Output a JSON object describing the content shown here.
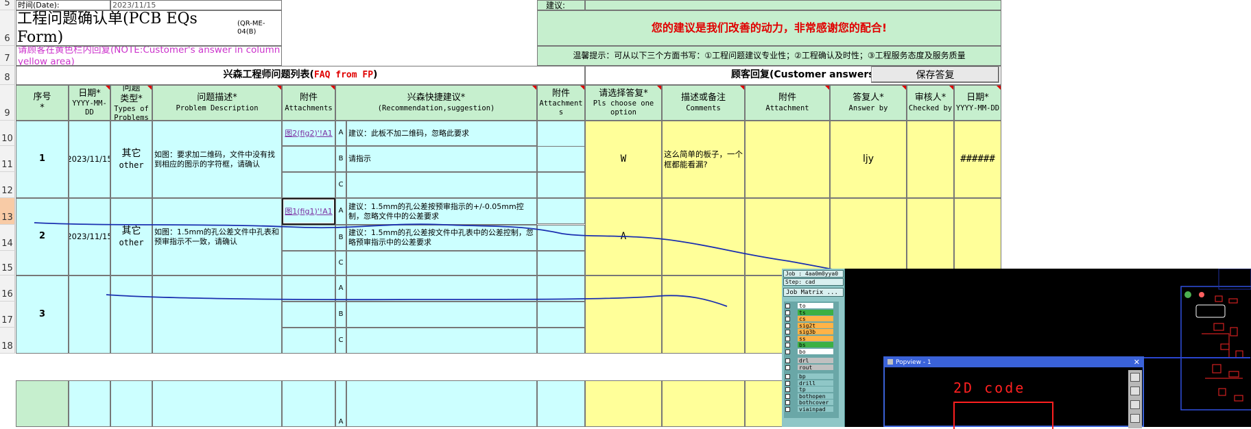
{
  "row_headers": [
    "5",
    "6",
    "7",
    "8",
    "9",
    "10",
    "11",
    "12",
    "13",
    "14",
    "15",
    "16",
    "17",
    "18"
  ],
  "top": {
    "row5_label": "时间(Date):",
    "row5_date": "2023/11/15",
    "title": "工程问题确认单(PCB EQs Form)",
    "form_code": "(QR-ME-04(B)",
    "instruction": "请顾客在黄色栏内回复(NOTE:Customer's answer in column yellow area)",
    "suggest_label": "建议:",
    "thanks": "您的建议是我们改善的动力，非常感谢您的配合!",
    "tip": "温馨提示：可从以下三个方面书写：①工程问题建议专业性；②工程确认及时性；③工程服务态度及服务质量"
  },
  "section": {
    "left_title_cn": "兴森工程师问题列表(",
    "left_title_en": "FAQ from FP",
    "left_title_close": ")",
    "right_title": "顾客回复(Customer answers)",
    "save_button": "保存答复"
  },
  "headers": {
    "seq": [
      "序号",
      "*"
    ],
    "date": [
      "日期*",
      "YYYY-MM-DD"
    ],
    "type": [
      "问题",
      "类型*",
      "Types of",
      "Problems"
    ],
    "desc": [
      "问题描述*",
      "Problem Description"
    ],
    "attach": [
      "附件",
      "Attachments"
    ],
    "rec": [
      "兴森快捷建议*",
      "(Recommendation,suggestion)"
    ],
    "attach2": [
      "附件",
      "Attachment",
      "s"
    ],
    "choose": [
      "请选择答复*",
      "Pls choose one option"
    ],
    "comments": [
      "描述或备注",
      "Comments"
    ],
    "cattach": [
      "附件",
      "Attachment"
    ],
    "answer_by": [
      "答复人*",
      "Answer by"
    ],
    "checked_by": [
      "审核人*",
      "Checked by"
    ],
    "cdate": [
      "日期*",
      "YYYY-MM-DD"
    ]
  },
  "rows": [
    {
      "seq": "1",
      "date": "2023/11/15",
      "type_cn": "其它",
      "type_en": "other",
      "desc": "如图：要求加二维码，文件中没有找到相应的图示的字符框，请确认",
      "attachment": "图2(fig2)'!A1",
      "options": [
        {
          "letter": "A",
          "text": "建议：此板不加二维码，忽略此要求"
        },
        {
          "letter": "B",
          "text": "请指示"
        },
        {
          "letter": "C",
          "text": ""
        }
      ],
      "choice": "W",
      "comment": "这么简单的板子，一个框都能看漏?",
      "answer_by": "ljy",
      "cdate": "######"
    },
    {
      "seq": "2",
      "date": "2023/11/15",
      "type_cn": "其它",
      "type_en": "other",
      "desc": "如图：1.5mm的孔公差文件中孔表和预审指示不一致，请确认",
      "attachment": "图1(fig1)'!A1",
      "options": [
        {
          "letter": "A",
          "text": "建议：1.5mm的孔公差按预审指示的+/-0.05mm控制，忽略文件中的公差要求"
        },
        {
          "letter": "B",
          "text": "建议：1.5mm的孔公差按文件中孔表中的公差控制，忽略预审指示中的公差要求"
        },
        {
          "letter": "C",
          "text": ""
        }
      ],
      "choice": "A"
    },
    {
      "seq": "3",
      "options": [
        {
          "letter": "A",
          "text": ""
        },
        {
          "letter": "B",
          "text": ""
        },
        {
          "letter": "C",
          "text": ""
        }
      ]
    }
  ],
  "row4_partial_letter": "A",
  "cad": {
    "job": "Job : 4aa0m0yya0",
    "step": "Step: cad",
    "matrix_button": "Job Matrix ...",
    "layers": [
      {
        "name": "to",
        "color": "#ffffff"
      },
      {
        "name": "ts",
        "color": "#3cb043"
      },
      {
        "name": "cs",
        "color": "#ffb347"
      },
      {
        "name": "sig2t",
        "color": "#ffb347"
      },
      {
        "name": "sig3b",
        "color": "#ffb347"
      },
      {
        "name": "ss",
        "color": "#ffb347"
      },
      {
        "name": "bs",
        "color": "#3cb043"
      },
      {
        "name": "bo",
        "color": "#ffffff"
      },
      {
        "name": "drl",
        "color": "#c0c0c0"
      },
      {
        "name": "rout",
        "color": "#c0c0c0"
      },
      {
        "name": "bp",
        "color": "#8fc7c7"
      },
      {
        "name": "drill",
        "color": "#8fc7c7"
      },
      {
        "name": "tp",
        "color": "#8fc7c7"
      },
      {
        "name": "bothopen",
        "color": "#8fc7c7"
      },
      {
        "name": "bothcover",
        "color": "#8fc7c7"
      },
      {
        "name": "viainpad",
        "color": "#8fc7c7"
      }
    ],
    "popview_title": "Popview - 1",
    "popview_text": "2D code"
  },
  "colors": {
    "green_header": "#c6efce",
    "light_blue": "#ccffff",
    "yellow": "#ffff99",
    "red_text": "#e00000",
    "magenta_text": "#cc33cc",
    "annotation_pen": "#1a2fb0"
  }
}
